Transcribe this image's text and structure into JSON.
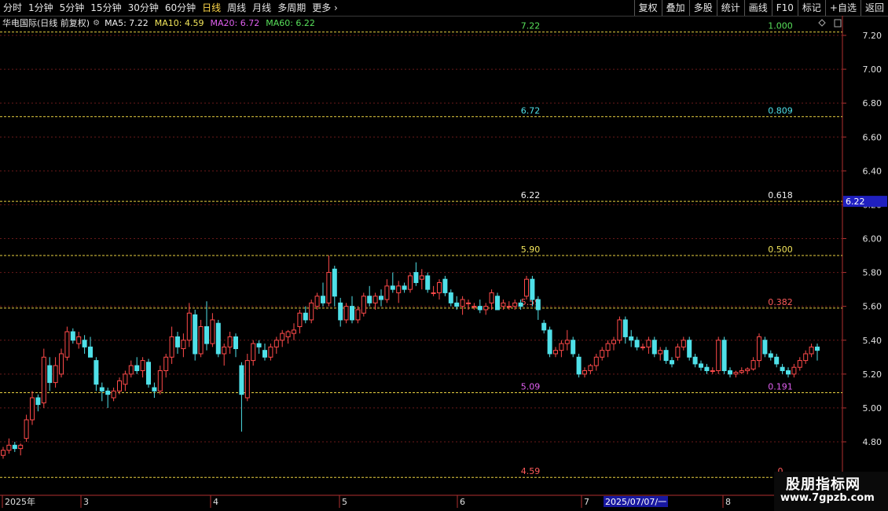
{
  "toolbar": {
    "timeframes": [
      "分时",
      "1分钟",
      "5分钟",
      "15分钟",
      "30分钟",
      "60分钟",
      "日线",
      "周线",
      "月线",
      "多周期",
      "更多"
    ],
    "active_timeframe": "日线",
    "more_chevron": "›",
    "tools": [
      "复权",
      "叠加",
      "多股",
      "统计",
      "画线",
      "F10",
      "+自选",
      "返回"
    ],
    "mark_label": "标记"
  },
  "info": {
    "title": "华电国际(日线 前复权)",
    "ma5": "MA5: 7.22",
    "ma10": "MA10: 4.59",
    "ma20": "MA20: 6.72",
    "ma60": "MA60: 6.22"
  },
  "colors": {
    "up": "#ff4a4a",
    "down": "#4fe0e8",
    "axis": "#b03030",
    "grid": "#6a1a1a",
    "fib": "#e8d040",
    "price_box": "#2020c0",
    "date_box": "#1818a0"
  },
  "chart_data": {
    "type": "candlestick",
    "y_ticks": [
      "7.20",
      "7.00",
      "6.80",
      "6.60",
      "6.40",
      "6.20",
      "6.00",
      "5.80",
      "5.60",
      "5.40",
      "5.20",
      "5.00",
      "4.80"
    ],
    "ylim": [
      4.65,
      7.24
    ],
    "x_labels": [
      "2025年",
      "3",
      "4",
      "5",
      "6",
      "7",
      "8"
    ],
    "current_price": "6.22",
    "crosshair_date": "2025/07/07/一",
    "fib_levels": [
      {
        "price": 7.22,
        "label": "7.22",
        "ratio": "1.000",
        "color": "#58e05a"
      },
      {
        "price": 6.72,
        "label": "6.72",
        "ratio": "0.809",
        "color": "#4fe0e8"
      },
      {
        "price": 6.22,
        "label": "6.22",
        "ratio": "0.618",
        "color": "#f0f0f0"
      },
      {
        "price": 5.9,
        "label": "5.90",
        "ratio": "0.500",
        "color": "#f3e65b"
      },
      {
        "price": 5.59,
        "label": "5.59",
        "ratio": "0.382",
        "color": "#ff5a5a"
      },
      {
        "price": 5.09,
        "label": "5.09",
        "ratio": "0.191",
        "color": "#e05ff0"
      },
      {
        "price": 4.59,
        "label": "4.59",
        "ratio": "0",
        "color": "#ff5a5a"
      }
    ],
    "candles": [
      [
        4.72,
        4.77,
        4.7,
        4.75
      ],
      [
        4.75,
        4.82,
        4.73,
        4.78
      ],
      [
        4.78,
        4.8,
        4.74,
        4.76
      ],
      [
        4.76,
        4.79,
        4.72,
        4.78
      ],
      [
        4.82,
        4.96,
        4.8,
        4.93
      ],
      [
        4.93,
        5.1,
        4.9,
        5.06
      ],
      [
        5.06,
        5.08,
        4.98,
        5.02
      ],
      [
        5.03,
        5.35,
        5.0,
        5.3
      ],
      [
        5.25,
        5.3,
        5.1,
        5.15
      ],
      [
        5.15,
        5.3,
        5.12,
        5.25
      ],
      [
        5.2,
        5.35,
        5.18,
        5.32
      ],
      [
        5.3,
        5.48,
        5.28,
        5.45
      ],
      [
        5.45,
        5.47,
        5.38,
        5.4
      ],
      [
        5.38,
        5.45,
        5.35,
        5.42
      ],
      [
        5.4,
        5.43,
        5.32,
        5.36
      ],
      [
        5.36,
        5.42,
        5.3,
        5.3
      ],
      [
        5.28,
        5.3,
        5.1,
        5.14
      ],
      [
        5.12,
        5.15,
        5.04,
        5.1
      ],
      [
        5.1,
        5.12,
        5.0,
        5.08
      ],
      [
        5.06,
        5.12,
        5.04,
        5.1
      ],
      [
        5.1,
        5.18,
        5.08,
        5.16
      ],
      [
        5.14,
        5.22,
        5.1,
        5.2
      ],
      [
        5.2,
        5.28,
        5.18,
        5.25
      ],
      [
        5.25,
        5.3,
        5.2,
        5.22
      ],
      [
        5.22,
        5.3,
        5.18,
        5.28
      ],
      [
        5.27,
        5.29,
        5.12,
        5.14
      ],
      [
        5.12,
        5.15,
        5.06,
        5.1
      ],
      [
        5.1,
        5.25,
        5.08,
        5.22
      ],
      [
        5.22,
        5.32,
        5.18,
        5.3
      ],
      [
        5.3,
        5.48,
        5.26,
        5.42
      ],
      [
        5.42,
        5.45,
        5.32,
        5.36
      ],
      [
        5.35,
        5.44,
        5.3,
        5.4
      ],
      [
        5.4,
        5.62,
        5.36,
        5.56
      ],
      [
        5.55,
        5.58,
        5.28,
        5.32
      ],
      [
        5.32,
        5.52,
        5.3,
        5.48
      ],
      [
        5.48,
        5.63,
        5.34,
        5.38
      ],
      [
        5.38,
        5.56,
        5.36,
        5.52
      ],
      [
        5.5,
        5.52,
        5.3,
        5.32
      ],
      [
        5.32,
        5.38,
        5.25,
        5.36
      ],
      [
        5.36,
        5.45,
        5.32,
        5.42
      ],
      [
        5.42,
        5.44,
        5.3,
        5.35
      ],
      [
        5.25,
        5.27,
        4.86,
        5.08
      ],
      [
        5.06,
        5.32,
        5.04,
        5.28
      ],
      [
        5.28,
        5.4,
        5.25,
        5.38
      ],
      [
        5.38,
        5.4,
        5.32,
        5.36
      ],
      [
        5.34,
        5.38,
        5.28,
        5.3
      ],
      [
        5.3,
        5.38,
        5.28,
        5.36
      ],
      [
        5.36,
        5.42,
        5.32,
        5.4
      ],
      [
        5.4,
        5.46,
        5.36,
        5.44
      ],
      [
        5.42,
        5.46,
        5.38,
        5.45
      ],
      [
        5.44,
        5.5,
        5.4,
        5.46
      ],
      [
        5.48,
        5.58,
        5.44,
        5.56
      ],
      [
        5.56,
        5.6,
        5.5,
        5.52
      ],
      [
        5.52,
        5.64,
        5.5,
        5.62
      ],
      [
        5.6,
        5.68,
        5.58,
        5.66
      ],
      [
        5.66,
        5.74,
        5.6,
        5.62
      ],
      [
        5.62,
        5.9,
        5.6,
        5.8
      ],
      [
        5.82,
        5.84,
        5.6,
        5.66
      ],
      [
        5.62,
        5.65,
        5.48,
        5.52
      ],
      [
        5.52,
        5.62,
        5.5,
        5.6
      ],
      [
        5.6,
        5.66,
        5.5,
        5.52
      ],
      [
        5.52,
        5.6,
        5.5,
        5.58
      ],
      [
        5.56,
        5.68,
        5.54,
        5.66
      ],
      [
        5.66,
        5.72,
        5.6,
        5.62
      ],
      [
        5.62,
        5.68,
        5.58,
        5.66
      ],
      [
        5.66,
        5.7,
        5.6,
        5.64
      ],
      [
        5.64,
        5.76,
        5.62,
        5.72
      ],
      [
        5.72,
        5.8,
        5.68,
        5.7
      ],
      [
        5.68,
        5.75,
        5.62,
        5.72
      ],
      [
        5.72,
        5.74,
        5.68,
        5.7
      ],
      [
        5.7,
        5.8,
        5.68,
        5.78
      ],
      [
        5.8,
        5.86,
        5.72,
        5.74
      ],
      [
        5.76,
        5.82,
        5.7,
        5.78
      ],
      [
        5.78,
        5.8,
        5.68,
        5.7
      ],
      [
        5.68,
        5.72,
        5.66,
        5.68
      ],
      [
        5.68,
        5.76,
        5.64,
        5.74
      ],
      [
        5.76,
        5.78,
        5.66,
        5.68
      ],
      [
        5.68,
        5.7,
        5.6,
        5.62
      ],
      [
        5.62,
        5.66,
        5.58,
        5.6
      ],
      [
        5.6,
        5.66,
        5.55,
        5.64
      ],
      [
        5.62,
        5.64,
        5.58,
        5.62
      ],
      [
        5.6,
        5.62,
        5.58,
        5.6
      ],
      [
        5.6,
        5.64,
        5.56,
        5.58
      ],
      [
        5.58,
        5.62,
        5.55,
        5.6
      ],
      [
        5.62,
        5.7,
        5.58,
        5.68
      ],
      [
        5.66,
        5.68,
        5.58,
        5.58
      ],
      [
        5.6,
        5.64,
        5.58,
        5.62
      ],
      [
        5.6,
        5.63,
        5.58,
        5.6
      ],
      [
        5.6,
        5.64,
        5.58,
        5.62
      ],
      [
        5.62,
        5.64,
        5.58,
        5.6
      ],
      [
        5.66,
        5.78,
        5.64,
        5.76
      ],
      [
        5.76,
        5.78,
        5.6,
        5.64
      ],
      [
        5.64,
        5.66,
        5.52,
        5.58
      ],
      [
        5.5,
        5.52,
        5.44,
        5.46
      ],
      [
        5.46,
        5.48,
        5.3,
        5.32
      ],
      [
        5.32,
        5.36,
        5.3,
        5.34
      ],
      [
        5.34,
        5.4,
        5.3,
        5.38
      ],
      [
        5.38,
        5.46,
        5.34,
        5.4
      ],
      [
        5.4,
        5.42,
        5.3,
        5.32
      ],
      [
        5.3,
        5.32,
        5.18,
        5.2
      ],
      [
        5.2,
        5.24,
        5.18,
        5.22
      ],
      [
        5.22,
        5.26,
        5.2,
        5.25
      ],
      [
        5.25,
        5.32,
        5.22,
        5.3
      ],
      [
        5.3,
        5.36,
        5.28,
        5.34
      ],
      [
        5.34,
        5.4,
        5.3,
        5.38
      ],
      [
        5.38,
        5.42,
        5.34,
        5.4
      ],
      [
        5.4,
        5.54,
        5.38,
        5.52
      ],
      [
        5.52,
        5.54,
        5.38,
        5.42
      ],
      [
        5.42,
        5.46,
        5.36,
        5.4
      ],
      [
        5.4,
        5.42,
        5.34,
        5.36
      ],
      [
        5.36,
        5.38,
        5.34,
        5.36
      ],
      [
        5.36,
        5.42,
        5.32,
        5.4
      ],
      [
        5.4,
        5.42,
        5.3,
        5.32
      ],
      [
        5.32,
        5.36,
        5.28,
        5.34
      ],
      [
        5.34,
        5.36,
        5.26,
        5.28
      ],
      [
        5.28,
        5.3,
        5.24,
        5.26
      ],
      [
        5.3,
        5.38,
        5.28,
        5.36
      ],
      [
        5.36,
        5.42,
        5.34,
        5.4
      ],
      [
        5.4,
        5.42,
        5.28,
        5.3
      ],
      [
        5.3,
        5.32,
        5.24,
        5.26
      ],
      [
        5.26,
        5.28,
        5.22,
        5.24
      ],
      [
        5.24,
        5.26,
        5.2,
        5.22
      ],
      [
        5.22,
        5.24,
        5.2,
        5.22
      ],
      [
        5.22,
        5.42,
        5.2,
        5.4
      ],
      [
        5.4,
        5.42,
        5.2,
        5.22
      ],
      [
        5.22,
        5.24,
        5.18,
        5.2
      ],
      [
        5.2,
        5.22,
        5.18,
        5.21
      ],
      [
        5.21,
        5.24,
        5.2,
        5.22
      ],
      [
        5.22,
        5.24,
        5.2,
        5.23
      ],
      [
        5.23,
        5.3,
        5.22,
        5.28
      ],
      [
        5.28,
        5.44,
        5.24,
        5.42
      ],
      [
        5.4,
        5.42,
        5.3,
        5.32
      ],
      [
        5.32,
        5.34,
        5.28,
        5.3
      ],
      [
        5.3,
        5.32,
        5.24,
        5.26
      ],
      [
        5.24,
        5.26,
        5.2,
        5.22
      ],
      [
        5.22,
        5.24,
        5.18,
        5.2
      ],
      [
        5.2,
        5.26,
        5.18,
        5.24
      ],
      [
        5.24,
        5.3,
        5.22,
        5.28
      ],
      [
        5.28,
        5.34,
        5.26,
        5.32
      ],
      [
        5.32,
        5.38,
        5.3,
        5.36
      ],
      [
        5.36,
        5.38,
        5.28,
        5.34
      ]
    ]
  },
  "watermark": {
    "line1": "股朋指标网",
    "line2": "www.7gpzb.com"
  }
}
